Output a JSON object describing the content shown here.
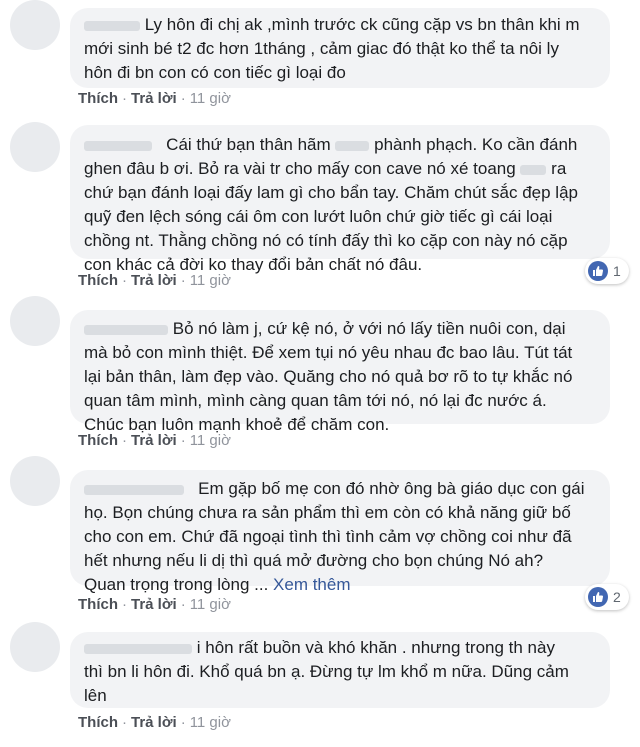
{
  "comments": [
    {
      "lines": [
        "Ly hôn đi chị ak ,mình trước ck cũng cặp vs bn thân khi m",
        "mới sinh bé t2 đc hơn 1tháng , cảm giac đó thật ko thể ta nôi ly",
        "hôn đi bn con có con tiếc gì loại đo"
      ],
      "like_label": "Thích",
      "reply_label": "Trả lời",
      "time": "11 giờ"
    },
    {
      "lines": [
        "Cái thứ bạn thân hãm",
        "phành phạch. Ko cần đánh",
        "ghen đâu b ơi. Bỏ ra vài tr cho mấy con cave nó xé toang",
        "ra",
        "chứ bạn đánh loại đấy lam gì cho bẩn tay. Chăm chút sắc đẹp lập",
        "quỹ đen lệch sóng cái ôm con lướt luôn chứ giờ tiếc gì cái loại",
        "chồng nt. Thằng chồng nó có tính đấy thì ko cặp con này nó cặp",
        "con khác cả đời ko thay đổi bản chất nó đâu."
      ],
      "like_label": "Thích",
      "reply_label": "Trả lời",
      "time": "11 giờ",
      "reaction_count": "1"
    },
    {
      "lines": [
        "Bỏ nó làm j, cứ kệ nó, ở với nó lấy tiền nuôi con, dại",
        "mà bỏ con mình thiệt. Để xem tụi nó yêu nhau đc bao lâu. Tút tát",
        "lại bản thân, làm đẹp vào. Quăng cho nó quả bơ rõ to tự khắc nó",
        "quan tâm mình, mình càng quan tâm tới nó, nó lại đc nước á.",
        "Chúc bạn luôn mạnh khoẻ để chăm con."
      ],
      "like_label": "Thích",
      "reply_label": "Trả lời",
      "time": "11 giờ"
    },
    {
      "lines": [
        "Em gặp bố mẹ con đó nhờ ông bà giáo dục con gái",
        "họ. Bọn chúng chưa ra sản phẩm thì em còn có khả năng giữ bố",
        "cho con em. Chứ đã ngoại tình thì tình cảm vợ chồng coi như đã",
        "hết nhưng nếu li dị thì quá mở đường cho bọn chúng Nó ah?",
        "Quan trọng trong lòng ..."
      ],
      "see_more": "Xem thêm",
      "like_label": "Thích",
      "reply_label": "Trả lời",
      "time": "11 giờ",
      "reaction_count": "2"
    },
    {
      "lines": [
        "i hôn rất buồn và khó khăn . nhưng trong th này",
        "thì bn li hôn đi. Khổ quá bn ạ. Đừng tự lm khổ m nữa. Dũng cảm",
        "lên"
      ],
      "like_label": "Thích",
      "reply_label": "Trả lời",
      "time": "11 giờ"
    }
  ],
  "colors": {
    "bubble": "#f2f3f5",
    "like_blue": "#4267b2",
    "link": "#365899"
  },
  "icons": {
    "reaction": "thumbs-up-icon"
  }
}
